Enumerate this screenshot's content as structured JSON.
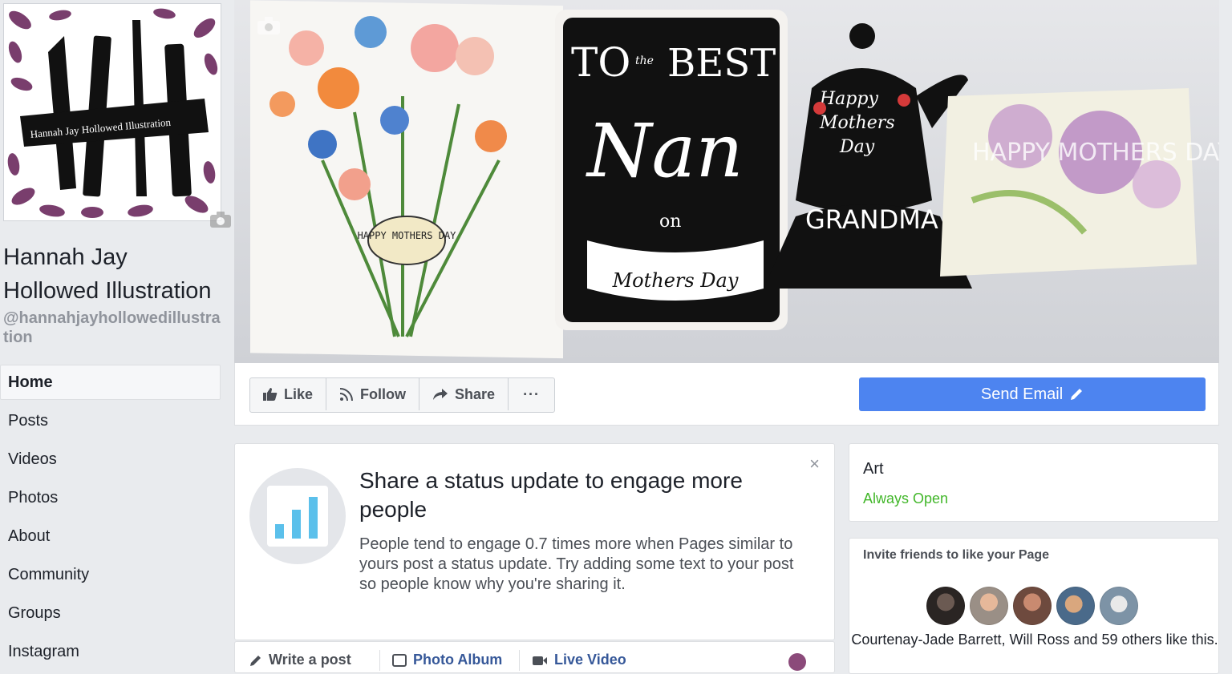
{
  "page": {
    "name": "Hannah Jay Hollowed Illustration",
    "handle": "@hannahjayhollowedillustration",
    "logo_text": "Hannah Jay Hollowed Illustration"
  },
  "cover": {
    "card1_text": "HAPPY MOTHERS DAY",
    "card2_text": [
      "TO",
      "the",
      "BEST",
      "Nan",
      "on",
      "Mothers Day"
    ],
    "card3_text": [
      "Happy",
      "Mothers",
      "Day",
      "GRANDMA"
    ],
    "card4_text": "HAPPY MOTHERS DAY"
  },
  "nav": {
    "items": [
      {
        "label": "Home",
        "active": true
      },
      {
        "label": "Posts"
      },
      {
        "label": "Videos"
      },
      {
        "label": "Photos"
      },
      {
        "label": "About"
      },
      {
        "label": "Community"
      },
      {
        "label": "Groups"
      },
      {
        "label": "Instagram"
      }
    ]
  },
  "actions": {
    "like": "Like",
    "follow": "Follow",
    "share": "Share",
    "more": "···",
    "send_email": "Send Email"
  },
  "status_prompt": {
    "title": "Share a status update to engage more people",
    "body": "People tend to engage 0.7 times more when Pages similar to yours post a status update. Try adding some text to your post so people know why you're sharing it.",
    "close": "×"
  },
  "composer": {
    "write_post": "Write a post",
    "photo_album": "Photo Album",
    "live_video": "Live Video"
  },
  "about_card": {
    "category": "Art",
    "hours": "Always Open"
  },
  "invite": {
    "title": "Invite friends to like your Page",
    "likers_text": "Courtenay-Jade Barrett, Will Ross and 59 others like this.",
    "avatar_colors": [
      "#2a2523",
      "#d9a88a",
      "#8d5a4e",
      "#b58f6a",
      "#8aa3b5"
    ]
  },
  "colors": {
    "brand_blue": "#4d84f0",
    "open_green": "#42b72a",
    "bar_icon": "#5bc0eb"
  }
}
